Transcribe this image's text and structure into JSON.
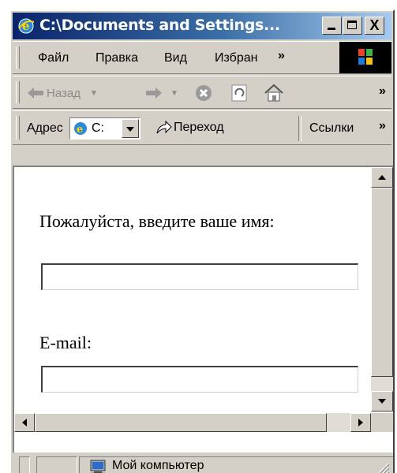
{
  "window": {
    "title": "C:\\Documents and Settings...",
    "close_glyph": "X"
  },
  "menubar": {
    "items": [
      "Файл",
      "Правка",
      "Вид",
      "Избран"
    ],
    "overflow": "»"
  },
  "toolbar": {
    "back_label": "Назад",
    "overflow": "»"
  },
  "addressbar": {
    "label": "Адрес",
    "value": "C:",
    "go_label": "Переход",
    "links_label": "Ссылки",
    "overflow": "»"
  },
  "form": {
    "name_prompt": "Пожалуйста, введите ваше имя:",
    "name_value": "",
    "email_label": "E-mail:",
    "email_value": ""
  },
  "statusbar": {
    "zone_text": "Мой компьютер"
  },
  "colors": {
    "titlebar_start": "#0a246a",
    "titlebar_end": "#a6caf0",
    "chrome": "#d4d0c8"
  }
}
